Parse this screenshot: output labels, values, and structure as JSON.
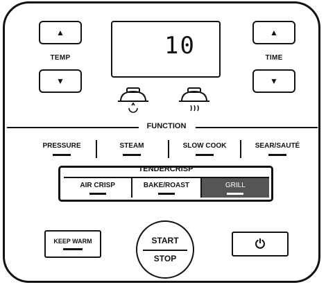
{
  "temp": {
    "label": "TEMP",
    "up": "▲",
    "down": "▼"
  },
  "time": {
    "label": "TIME",
    "up": "▲",
    "down": "▼"
  },
  "display": {
    "value": "10"
  },
  "function": {
    "title": "FUNCTION",
    "modes": [
      "PRESSURE",
      "STEAM",
      "SLOW COOK",
      "SEAR/SAUTÉ"
    ]
  },
  "tendercrisp": {
    "title": "TENDERCRISP",
    "modes": [
      "AIR CRISP",
      "BAKE/ROAST",
      "GRILL"
    ],
    "active": "GRILL"
  },
  "keep_warm": {
    "label": "KEEP WARM"
  },
  "start_stop": {
    "start": "START",
    "stop": "STOP"
  },
  "power": {
    "icon": "power-icon",
    "glyph": "⏻"
  }
}
